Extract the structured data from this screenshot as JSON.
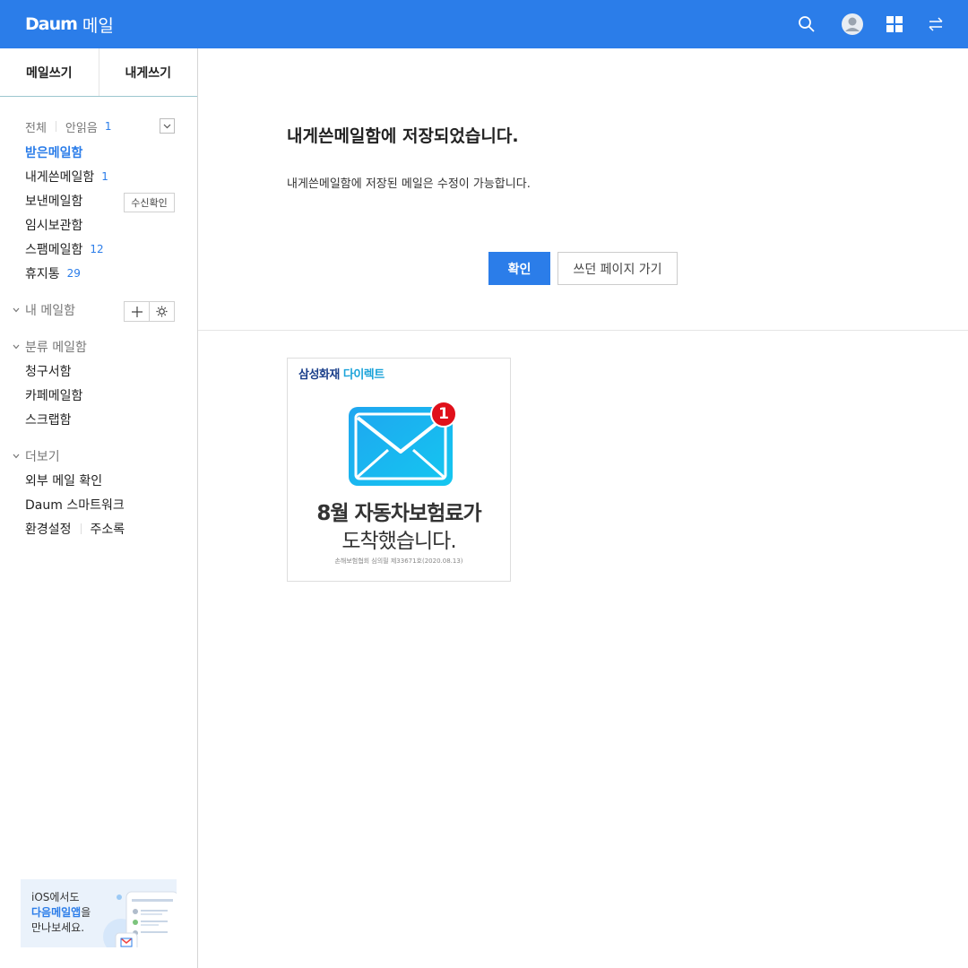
{
  "header": {
    "brand": "Daum",
    "service": "메일",
    "icons": [
      "search-icon",
      "profile-icon",
      "apps-grid-icon",
      "switch-icon"
    ]
  },
  "sidebar": {
    "write_mail": "메일쓰기",
    "write_to_me": "내게쓰기",
    "filter": {
      "all": "전체",
      "unread": "안읽음",
      "unread_count": "1"
    },
    "mailboxes": [
      {
        "label": "받은메일함",
        "count": ""
      },
      {
        "label": "내게쓴메일함",
        "count": "1"
      },
      {
        "label": "보낸메일함",
        "count": ""
      },
      {
        "label": "임시보관함",
        "count": ""
      },
      {
        "label": "스팸메일함",
        "count": "12"
      },
      {
        "label": "휴지통",
        "count": "29"
      }
    ],
    "receipt_check": "수신확인",
    "my_mailbox": "내 메일함",
    "category": {
      "title": "분류 메일함",
      "items": [
        "청구서함",
        "카페메일함",
        "스크랩함"
      ]
    },
    "more": {
      "title": "더보기",
      "items": [
        "외부 메일 확인",
        "Daum 스마트워크"
      ],
      "settings": "환경설정",
      "address_book": "주소록"
    },
    "promo": {
      "line1": "iOS에서도",
      "line2_highlight": "다음메일앱",
      "line2_rest": "을",
      "line3": "만나보세요."
    }
  },
  "main": {
    "title": "내게쓴메일함에 저장되었습니다.",
    "description": "내게쓴메일함에 저장된 메일은 수정이 가능합니다.",
    "confirm_button": "확인",
    "back_button": "쓰던 페이지 가기",
    "ad": {
      "brand_part1": "삼성화재",
      "brand_part2": "다이렉트",
      "badge": "1",
      "headline1": "8월 자동차보험료가",
      "headline2": "도착했습니다.",
      "fineprint": "손해보험협회 심의필 제33671호(2020.08.13)"
    }
  },
  "colors": {
    "accent": "#2b7de9",
    "topbar": "#2b7de9"
  }
}
